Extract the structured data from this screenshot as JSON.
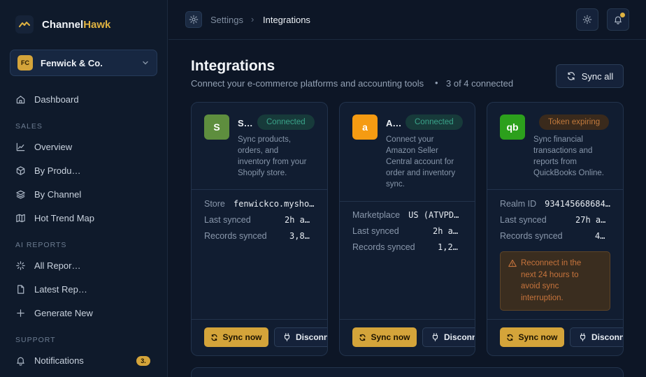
{
  "brand": {
    "name_main": "Channel",
    "name_accent": "Hawk"
  },
  "org": {
    "initials": "FC",
    "name": "Fenwick & Co."
  },
  "sidebar": {
    "items": [
      {
        "label": "Dashboard",
        "icon": "home-icon"
      },
      {
        "section": "SALES"
      },
      {
        "label": "Overview",
        "icon": "line-chart-icon"
      },
      {
        "label": "By Produ…",
        "icon": "box-icon"
      },
      {
        "label": "By Channel",
        "icon": "layers-icon"
      },
      {
        "label": "Hot Trend Map",
        "icon": "map-icon"
      },
      {
        "section": "AI REPORTS"
      },
      {
        "label": "All Repor…",
        "icon": "sparkle-icon"
      },
      {
        "label": "Latest Rep…",
        "icon": "file-icon"
      },
      {
        "label": "Generate New",
        "icon": "plus-icon"
      },
      {
        "section": "SUPPORT"
      },
      {
        "label": "Notifications",
        "icon": "bell-icon",
        "badge": "3."
      }
    ]
  },
  "topbar": {
    "breadcrumb_parent": "Settings",
    "breadcrumb_separator": "›",
    "breadcrumb_current": "Integrations"
  },
  "page": {
    "title": "Integrations",
    "subtitle": "Connect your e-commerce platforms and accounting tools",
    "dot": "•",
    "connected_count": "3 of 4 connected",
    "sync_all_label": "Sync all"
  },
  "cards": [
    {
      "logo_letter": "S",
      "logo_color": "#5e8e3e",
      "name": "S…",
      "status": "Connected",
      "status_kind": "ok",
      "desc": [
        "Sync products,",
        "orders, and",
        "inventory from your",
        "Shopify store."
      ],
      "fields": [
        {
          "label": "Store",
          "value": "fenwickco.mysho…"
        },
        {
          "label": "Last synced",
          "value": "2h a…"
        },
        {
          "label": "Records synced",
          "value": "3,8…"
        }
      ],
      "sync_label": "Sync now",
      "disconnect_label": "Disconne"
    },
    {
      "logo_letter": "a",
      "logo_color": "#f59b12",
      "name": "A…",
      "status": "Connected",
      "status_kind": "ok",
      "desc": [
        "Connect your",
        "Amazon Seller",
        "Central account for",
        "order and inventory",
        "sync."
      ],
      "fields": [
        {
          "label": "Marketplace",
          "value": "US (ATVPD…"
        },
        {
          "label": "Last synced",
          "value": "2h a…"
        },
        {
          "label": "Records synced",
          "value": "1,2…"
        }
      ],
      "sync_label": "Sync now",
      "disconnect_label": "Disconne"
    },
    {
      "logo_letter": "qb",
      "logo_color": "#2ca01c",
      "name": "",
      "status": "Token expiring",
      "status_kind": "warn",
      "desc": [
        "Sync financial",
        "transactions and",
        "reports from",
        "QuickBooks Online."
      ],
      "fields": [
        {
          "label": "Realm ID",
          "value": "934145668684…"
        },
        {
          "label": "Last synced",
          "value": "27h a…"
        },
        {
          "label": "Records synced",
          "value": "4…"
        }
      ],
      "warning": [
        "Reconnect in the",
        "next 24 hours to",
        "avoid sync",
        "interruption."
      ],
      "sync_label": "Sync now",
      "disconnect_label": "Disconne"
    }
  ]
}
